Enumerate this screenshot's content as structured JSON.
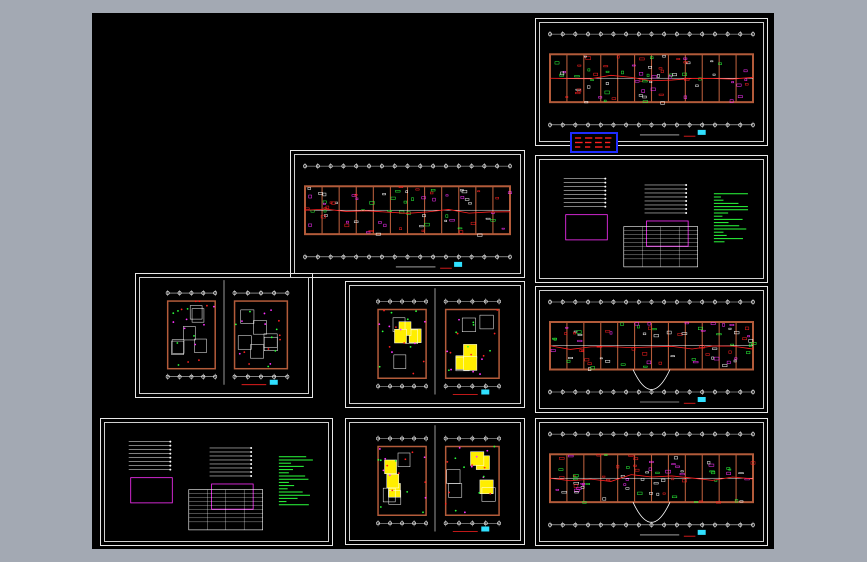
{
  "window": {
    "background": "#a3a9b3",
    "model_space_color": "#000000"
  },
  "drawing": {
    "sheets": [
      {
        "id": "plan-top-right",
        "kind": "long-plan"
      },
      {
        "id": "plan-middle",
        "kind": "long-plan"
      },
      {
        "id": "schedule-right",
        "kind": "schedule"
      },
      {
        "id": "small-plans-left",
        "kind": "small-plans"
      },
      {
        "id": "yellow-plans-upper",
        "kind": "yellow-plans"
      },
      {
        "id": "plan-right-middle",
        "kind": "long-plan-curved"
      },
      {
        "id": "schedule-bottom-left",
        "kind": "schedule"
      },
      {
        "id": "yellow-plans-lower",
        "kind": "yellow-plans"
      },
      {
        "id": "plan-bottom-right",
        "kind": "long-plan-curved"
      }
    ],
    "legend_block": {
      "border_color": "#1e2cff",
      "text_color": "#ff2020"
    }
  },
  "colors": {
    "grid_line": "#d0d0d0",
    "wall": "#b35b3a",
    "green": "#2bff3c",
    "red": "#ff2020",
    "magenta": "#ff30ff",
    "cyan": "#30e0ff",
    "yellow": "#ffee00",
    "white": "#ffffff"
  }
}
